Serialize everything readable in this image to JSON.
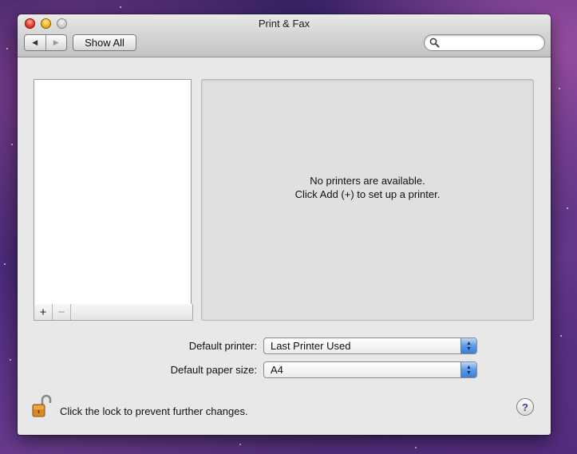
{
  "window": {
    "title": "Print & Fax"
  },
  "toolbar": {
    "back_icon": "back-arrow-icon",
    "forward_icon": "forward-arrow-icon",
    "show_all_label": "Show All",
    "search": {
      "value": "",
      "placeholder": ""
    }
  },
  "printer_list": {
    "items": [],
    "add_label": "+",
    "remove_label": "−"
  },
  "detail": {
    "message_line1": "No printers are available.",
    "message_line2": "Click Add (+) to set up a printer."
  },
  "settings": {
    "default_printer": {
      "label": "Default printer:",
      "value": "Last Printer Used"
    },
    "default_paper_size": {
      "label": "Default paper size:",
      "value": "A4"
    }
  },
  "footer": {
    "lock_text": "Click the lock to prevent further changes.",
    "help_label": "?"
  },
  "colors": {
    "accent_popup": "#5b9ae6",
    "help_mark": "#5c2ca0",
    "lock": "#c07a1a"
  }
}
